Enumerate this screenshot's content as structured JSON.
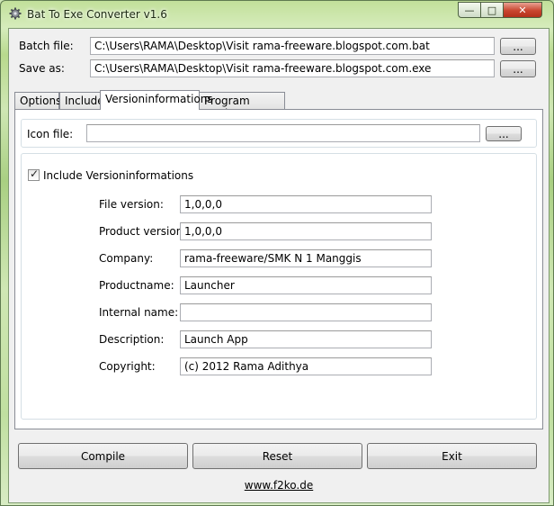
{
  "window": {
    "title": "Bat To Exe Converter v1.6",
    "minimize_glyph": "—",
    "maximize_glyph": "□",
    "close_glyph": "✕"
  },
  "files": {
    "batch_label": "Batch file:",
    "batch_value": "C:\\Users\\RAMA\\Desktop\\Visit rama-freeware.blogspot.com.bat",
    "save_label": "Save as:",
    "save_value": "C:\\Users\\RAMA\\Desktop\\Visit rama-freeware.blogspot.com.exe",
    "browse_label": "..."
  },
  "tabs": [
    "Options",
    "Include",
    "Versioninformations",
    "Program settings"
  ],
  "icon": {
    "label": "Icon file:",
    "value": "",
    "browse_label": "..."
  },
  "version": {
    "include_label": "Include Versioninformations",
    "include_checked": true,
    "fields": [
      {
        "label": "File version:",
        "value": "1,0,0,0"
      },
      {
        "label": "Product version:",
        "value": "1,0,0,0"
      },
      {
        "label": "Company:",
        "value": "rama-freeware/SMK N 1 Manggis"
      },
      {
        "label": "Productname:",
        "value": "Launcher"
      },
      {
        "label": "Internal name:",
        "value": ""
      },
      {
        "label": "Description:",
        "value": "Launch App"
      },
      {
        "label": "Copyright:",
        "value": "(c) 2012 Rama Adithya"
      }
    ]
  },
  "actions": {
    "compile": "Compile",
    "reset": "Reset",
    "exit": "Exit"
  },
  "footer": {
    "link": "www.f2ko.de"
  }
}
